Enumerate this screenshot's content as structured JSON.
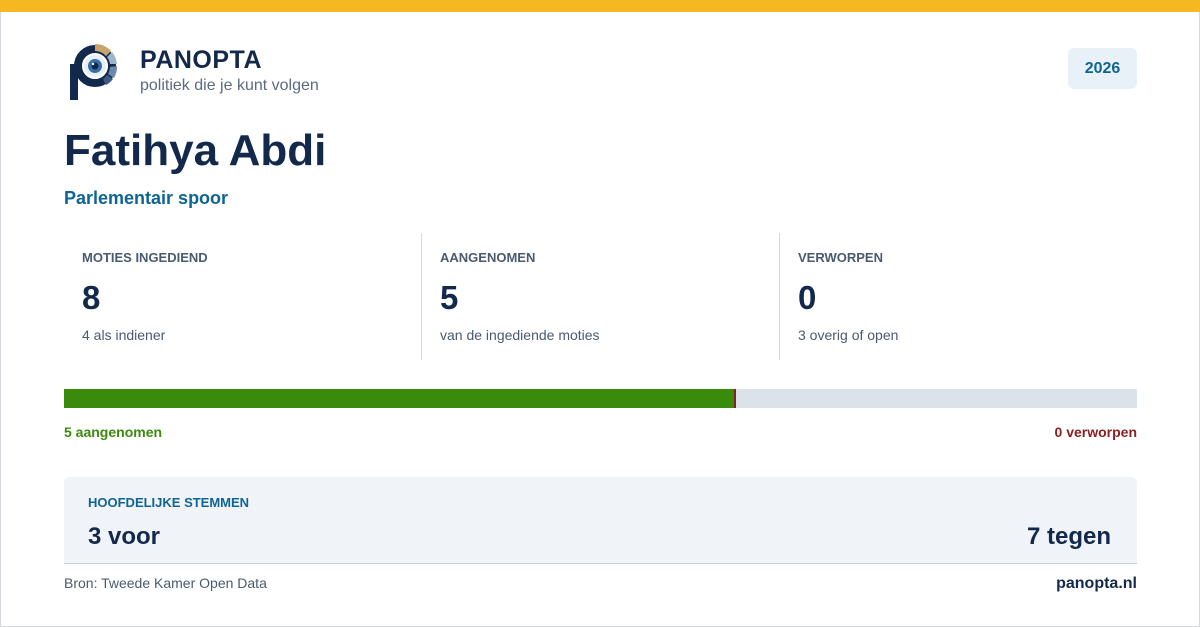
{
  "brand": {
    "name": "PANOPTA",
    "tagline": "politiek die je kunt volgen",
    "year": "2026"
  },
  "person": {
    "name": "Fatihya Abdi",
    "subtitle": "Parlementair spoor"
  },
  "stats": [
    {
      "label": "MOTIES INGEDIEND",
      "value": "8",
      "note": "4 als indiener"
    },
    {
      "label": "AANGENOMEN",
      "value": "5",
      "note": "van de ingediende moties"
    },
    {
      "label": "VERWORPEN",
      "value": "0",
      "note": "3 overig of open"
    }
  ],
  "progress": {
    "accepted_fraction": 0.625,
    "accepted_label": "5 aangenomen",
    "rejected_label": "0 verworpen"
  },
  "votes": {
    "label": "HOOFDELIJKE STEMMEN",
    "for": "3 voor",
    "against": "7 tegen"
  },
  "footer": {
    "source": "Bron: Tweede Kamer Open Data",
    "site": "panopta.nl"
  },
  "colors": {
    "accent_yellow": "#f6b822",
    "navy": "#13294b",
    "blue": "#0e6494",
    "green": "#3a8a0c",
    "red": "#8a1f1f"
  },
  "icons": {
    "logo": "panopta-eye-logo"
  }
}
